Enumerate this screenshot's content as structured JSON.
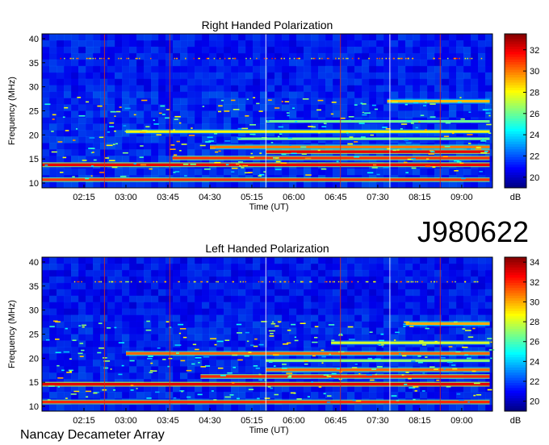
{
  "figure_id": "J980622",
  "footer": "Nancay Decameter Array",
  "chart_data": [
    {
      "type": "heatmap",
      "title": "Right Handed Polarization",
      "xlabel": "Time (UT)",
      "ylabel": "Frequency (MHz)",
      "x_ticks": [
        "02:15",
        "03:00",
        "03:45",
        "04:30",
        "05:15",
        "06:00",
        "06:45",
        "07:30",
        "08:15",
        "09:00"
      ],
      "x_range_hours": [
        1.5,
        9.55
      ],
      "ylim": [
        9,
        41
      ],
      "y_ticks": [
        10,
        15,
        20,
        25,
        30,
        35,
        40
      ],
      "colorbar": {
        "label": "dB",
        "range": [
          19,
          33.5
        ],
        "ticks": [
          20,
          22,
          24,
          26,
          28,
          30,
          32
        ]
      },
      "emission_bands_mhz": [
        {
          "freq": 10.7,
          "level": 31,
          "start": "01:30",
          "end": "09:30"
        },
        {
          "freq": 13.8,
          "level": 32,
          "start": "01:30",
          "end": "09:30"
        },
        {
          "freq": 15.2,
          "level": 31,
          "start": "03:50",
          "end": "09:30"
        },
        {
          "freq": 16.5,
          "level": 32,
          "start": "05:30",
          "end": "09:30"
        },
        {
          "freq": 17.5,
          "level": 30,
          "start": "04:30",
          "end": "09:30"
        },
        {
          "freq": 19.2,
          "level": 26,
          "start": "05:00",
          "end": "09:30"
        },
        {
          "freq": 20.7,
          "level": 28,
          "start": "03:00",
          "end": "09:30"
        },
        {
          "freq": 22.8,
          "level": 26,
          "start": "05:30",
          "end": "09:30"
        },
        {
          "freq": 27.0,
          "level": 29,
          "start": "07:40",
          "end": "09:30"
        }
      ]
    },
    {
      "type": "heatmap",
      "title": "Left Handed Polarization",
      "xlabel": "Time (UT)",
      "ylabel": "Frequency (MHz)",
      "x_ticks": [
        "02:15",
        "03:00",
        "03:45",
        "04:30",
        "05:15",
        "06:00",
        "06:45",
        "07:30",
        "08:15",
        "09:00"
      ],
      "x_range_hours": [
        1.5,
        9.55
      ],
      "ylim": [
        9,
        41
      ],
      "y_ticks": [
        10,
        15,
        20,
        25,
        30,
        35,
        40
      ],
      "colorbar": {
        "label": "dB",
        "range": [
          19,
          34.5
        ],
        "ticks": [
          20,
          22,
          24,
          26,
          28,
          30,
          32,
          34
        ]
      },
      "emission_bands_mhz": [
        {
          "freq": 10.9,
          "level": 32,
          "start": "01:30",
          "end": "09:30"
        },
        {
          "freq": 14.6,
          "level": 33,
          "start": "01:30",
          "end": "09:30"
        },
        {
          "freq": 16.2,
          "level": 32,
          "start": "04:20",
          "end": "09:30"
        },
        {
          "freq": 17.6,
          "level": 31,
          "start": "05:30",
          "end": "09:30"
        },
        {
          "freq": 19.5,
          "level": 27,
          "start": "05:30",
          "end": "09:30"
        },
        {
          "freq": 21.0,
          "level": 31,
          "start": "03:00",
          "end": "09:30"
        },
        {
          "freq": 23.2,
          "level": 28,
          "start": "06:40",
          "end": "09:30"
        },
        {
          "freq": 27.2,
          "level": 30,
          "start": "08:00",
          "end": "09:30"
        }
      ]
    }
  ]
}
